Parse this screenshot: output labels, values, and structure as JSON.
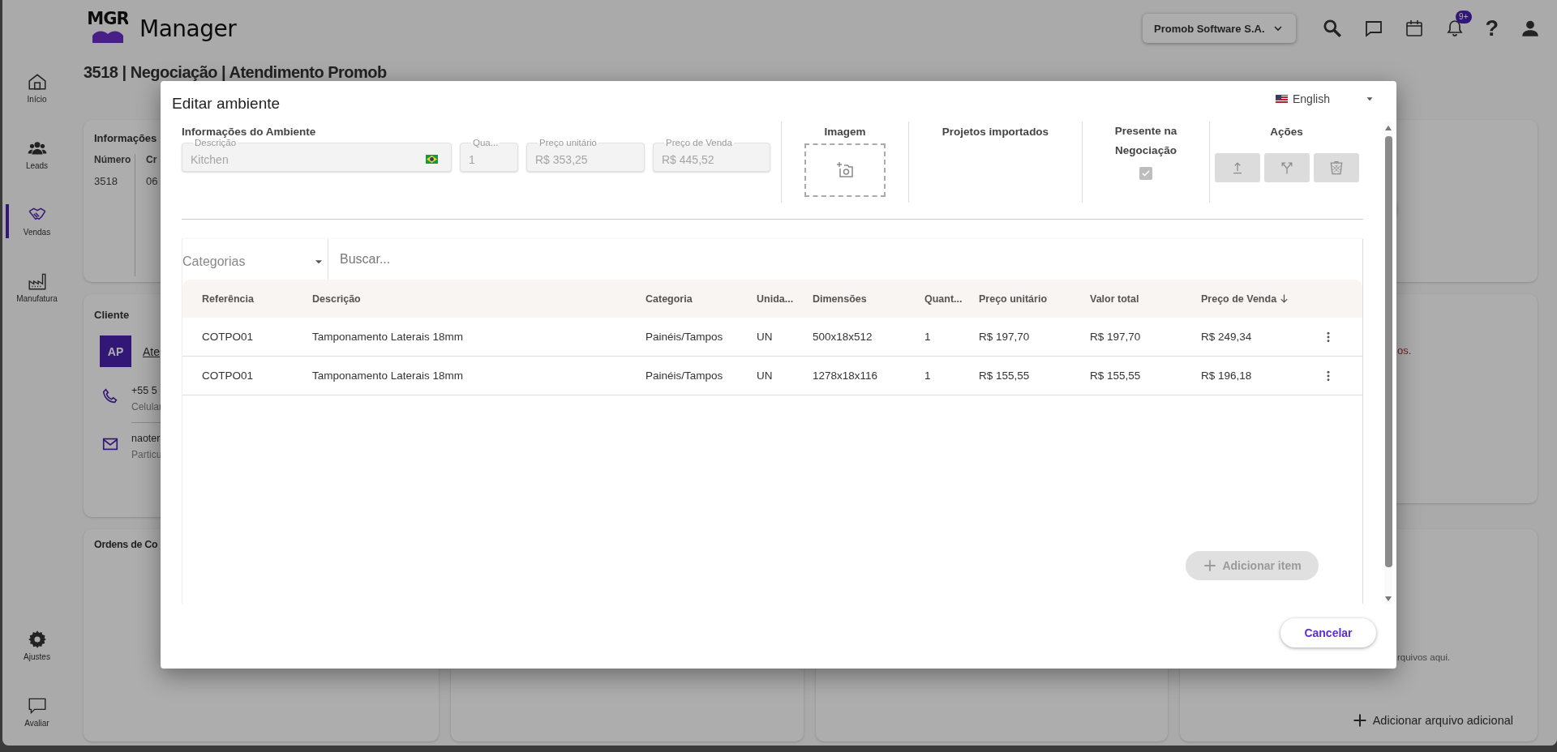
{
  "app": {
    "logo": "MGR",
    "title": "Manager",
    "company": "Promob Software S.A.",
    "notification_badge": "9+",
    "help": "?",
    "sidebar": [
      {
        "label": "Início",
        "kind": "home",
        "selected": false
      },
      {
        "label": "Leads",
        "kind": "leads",
        "selected": false
      },
      {
        "label": "Vendas",
        "kind": "sales",
        "selected": true
      },
      {
        "label": "Manufatura",
        "kind": "factory",
        "selected": false
      },
      {
        "label": "Ajustes",
        "kind": "settings",
        "selected": false
      },
      {
        "label": "Avaliar",
        "kind": "feedback",
        "selected": false
      }
    ],
    "page_title": "3518 | Negociação | Atendimento Promob",
    "info_card": {
      "title": "Informações",
      "fields": [
        {
          "label": "Número",
          "value": "3518"
        },
        {
          "label": "Cr",
          "value": "06"
        }
      ]
    },
    "client_card": {
      "title": "Cliente",
      "avatar": "AP",
      "name": "Ate",
      "contacts": [
        {
          "kind": "phone",
          "value": "+55 5",
          "type": "Celular"
        },
        {
          "kind": "email",
          "value": "naoter",
          "type": "Particu"
        }
      ]
    },
    "orders_card": {
      "title": "Ordens de Co"
    },
    "right_note": "os.",
    "files_hint": "rquivos aqui.",
    "add_file_button": "Adicionar arquivo adicional"
  },
  "dialog": {
    "title": "Editar ambiente",
    "language": "English",
    "section_title": "Informações do Ambiente",
    "fields": [
      {
        "label": "Descrição",
        "value": "Kitchen",
        "disabled": true
      },
      {
        "label": "Qua...",
        "value": "1",
        "disabled": true
      },
      {
        "label": "Preço unitário",
        "value": "R$ 353,25",
        "disabled": true
      },
      {
        "label": "Preço de Venda",
        "value": "R$ 445,52",
        "disabled": true
      }
    ],
    "image_title": "Imagem",
    "imported_title": "Projetos importados",
    "present": {
      "title": "Presente na Negociação",
      "checked": true,
      "disabled": true
    },
    "actions_title": "Ações",
    "actions": [
      {
        "kind": "upload",
        "disabled": true
      },
      {
        "kind": "split",
        "disabled": true
      },
      {
        "kind": "delete",
        "disabled": true
      }
    ],
    "category_filter": {
      "label": "Categorias"
    },
    "search": {
      "placeholder": "Buscar..."
    },
    "table": {
      "columns": [
        {
          "label": "Referência",
          "sorted": false
        },
        {
          "label": "Descrição",
          "sorted": false
        },
        {
          "label": "Categoria",
          "sorted": false
        },
        {
          "label": "Unida...",
          "sorted": false
        },
        {
          "label": "Dimensões",
          "sorted": false
        },
        {
          "label": "Quant...",
          "sorted": false
        },
        {
          "label": "Preço unitário",
          "sorted": false
        },
        {
          "label": "Valor total",
          "sorted": false
        },
        {
          "label": "Preço de Venda",
          "sorted": true
        }
      ],
      "rows": [
        [
          "COTPO01",
          "Tamponamento Laterais 18mm",
          "Painéis/Tampos",
          "UN",
          "500x18x512",
          "1",
          "R$ 197,70",
          "R$ 197,70",
          "R$ 249,34"
        ],
        [
          "COTPO01",
          "Tamponamento Laterais 18mm",
          "Painéis/Tampos",
          "UN",
          "1278x18x116",
          "1",
          "R$ 155,55",
          "R$ 155,55",
          "R$ 196,18"
        ]
      ]
    },
    "add_item": {
      "label": "Adicionar item",
      "disabled": true
    },
    "cancel": "Cancelar"
  }
}
